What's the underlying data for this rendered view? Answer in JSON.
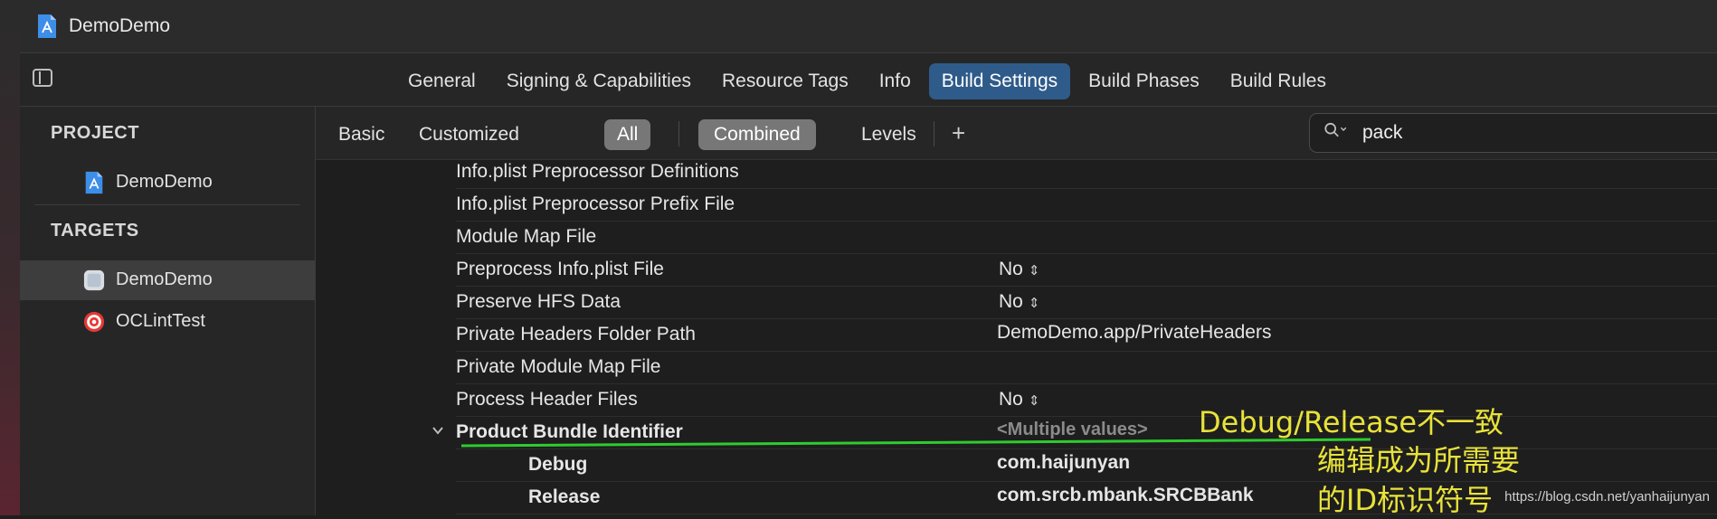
{
  "window": {
    "title": "DemoDemo"
  },
  "tabs": [
    {
      "label": "General",
      "active": false
    },
    {
      "label": "Signing & Capabilities",
      "active": false
    },
    {
      "label": "Resource Tags",
      "active": false
    },
    {
      "label": "Info",
      "active": false
    },
    {
      "label": "Build Settings",
      "active": true
    },
    {
      "label": "Build Phases",
      "active": false
    },
    {
      "label": "Build Rules",
      "active": false
    }
  ],
  "sidebar": {
    "project_header": "PROJECT",
    "project_item": "DemoDemo",
    "targets_header": "TARGETS",
    "targets": [
      {
        "label": "DemoDemo",
        "selected": true,
        "icon": "app-target-icon"
      },
      {
        "label": "OCLintTest",
        "selected": false,
        "icon": "target-bullseye-icon"
      }
    ]
  },
  "filters": {
    "basic": "Basic",
    "customized": "Customized",
    "all": "All",
    "combined": "Combined",
    "levels": "Levels",
    "add": "+"
  },
  "search": {
    "value": "pack"
  },
  "settings": [
    {
      "name": "Info.plist Preprocessor Definitions",
      "value": ""
    },
    {
      "name": "Info.plist Preprocessor Prefix File",
      "value": ""
    },
    {
      "name": "Module Map File",
      "value": ""
    },
    {
      "name": "Preprocess Info.plist File",
      "value": "No"
    },
    {
      "name": "Preserve HFS Data",
      "value": "No"
    },
    {
      "name": "Private Headers Folder Path",
      "value": "DemoDemo.app/PrivateHeaders"
    },
    {
      "name": "Private Module Map File",
      "value": ""
    },
    {
      "name": "Process Header Files",
      "value": "No"
    },
    {
      "name": "Product Bundle Identifier",
      "value": "<Multiple values>"
    },
    {
      "name": "Debug",
      "value": "com.haijunyan"
    },
    {
      "name": "Release",
      "value": "com.srcb.mbank.SRCBBank"
    }
  ],
  "annotations": {
    "line1": "Debug/Release不一致",
    "line2": "编辑成为所需要",
    "line3": "的ID标识符号",
    "watermark": "https://blog.csdn.net/yanhaijunyan"
  },
  "colors": {
    "accent_tab": "#2f5b8a",
    "annotation_text": "#e8e23a",
    "annotation_line": "#2ecc2e"
  }
}
